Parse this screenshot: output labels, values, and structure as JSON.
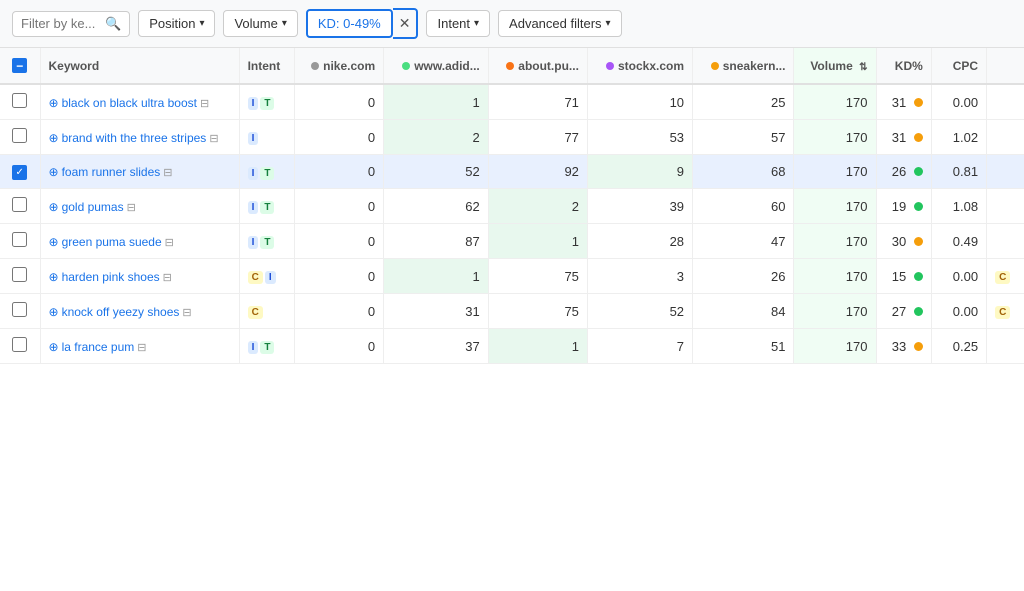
{
  "toolbar": {
    "filter_placeholder": "Filter by ke...",
    "position_label": "Position",
    "volume_label": "Volume",
    "kd_label": "KD: 0-49%",
    "intent_label": "Intent",
    "advanced_label": "Advanced filters"
  },
  "table": {
    "headers": [
      {
        "key": "check",
        "label": ""
      },
      {
        "key": "keyword",
        "label": "Keyword"
      },
      {
        "key": "intent",
        "label": "Intent"
      },
      {
        "key": "nike",
        "label": "nike.com"
      },
      {
        "key": "adidas",
        "label": "www.adid..."
      },
      {
        "key": "about",
        "label": "about.pu..."
      },
      {
        "key": "stockx",
        "label": "stockx.com"
      },
      {
        "key": "sneaker",
        "label": "sneakern..."
      },
      {
        "key": "volume",
        "label": "Volume"
      },
      {
        "key": "kd",
        "label": "KD%"
      },
      {
        "key": "cpc",
        "label": "CPC"
      },
      {
        "key": "extra",
        "label": ""
      }
    ],
    "rows": [
      {
        "id": 1,
        "checked": false,
        "selected": false,
        "keyword": "black on black ultra boost",
        "intents": [
          "I",
          "T"
        ],
        "nike": "0",
        "adidas": "1",
        "adidas_highlight": true,
        "about": "71",
        "stockx": "10",
        "sneaker": "25",
        "volume": "170",
        "kd": "31",
        "kd_color": "yellow",
        "cpc": "0.00",
        "extra": ""
      },
      {
        "id": 2,
        "checked": false,
        "selected": false,
        "keyword": "brand with the three stripes",
        "intents": [
          "I"
        ],
        "nike": "0",
        "adidas": "2",
        "adidas_highlight": true,
        "about": "77",
        "stockx": "53",
        "sneaker": "57",
        "volume": "170",
        "kd": "31",
        "kd_color": "yellow",
        "cpc": "1.02",
        "extra": ""
      },
      {
        "id": 3,
        "checked": true,
        "selected": true,
        "keyword": "foam runner slides",
        "intents": [
          "I",
          "T"
        ],
        "nike": "0",
        "adidas": "52",
        "adidas_highlight": false,
        "about": "92",
        "stockx": "9",
        "stockx_highlight": true,
        "sneaker": "68",
        "volume": "170",
        "kd": "26",
        "kd_color": "green",
        "cpc": "0.81",
        "extra": ""
      },
      {
        "id": 4,
        "checked": false,
        "selected": false,
        "keyword": "gold pumas",
        "intents": [
          "I",
          "T"
        ],
        "nike": "0",
        "adidas": "62",
        "adidas_highlight": false,
        "about": "2",
        "about_highlight": true,
        "stockx": "39",
        "sneaker": "60",
        "volume": "170",
        "kd": "19",
        "kd_color": "green",
        "cpc": "1.08",
        "extra": ""
      },
      {
        "id": 5,
        "checked": false,
        "selected": false,
        "keyword": "green puma suede",
        "intents": [
          "I",
          "T"
        ],
        "nike": "0",
        "adidas": "87",
        "adidas_highlight": false,
        "about": "1",
        "about_highlight": true,
        "stockx": "28",
        "sneaker": "47",
        "volume": "170",
        "kd": "30",
        "kd_color": "yellow",
        "cpc": "0.49",
        "extra": ""
      },
      {
        "id": 6,
        "checked": false,
        "selected": false,
        "keyword": "harden pink shoes",
        "intents": [
          "C",
          "I"
        ],
        "nike": "0",
        "adidas": "1",
        "adidas_highlight": true,
        "about": "75",
        "stockx": "3",
        "sneaker": "26",
        "volume": "170",
        "kd": "15",
        "kd_color": "green",
        "cpc": "0.00",
        "extra": "C"
      },
      {
        "id": 7,
        "checked": false,
        "selected": false,
        "keyword": "knock off yeezy shoes",
        "intents": [
          "C"
        ],
        "nike": "0",
        "adidas": "31",
        "adidas_highlight": false,
        "about": "75",
        "stockx": "52",
        "sneaker": "84",
        "volume": "170",
        "kd": "27",
        "kd_color": "green",
        "cpc": "0.00",
        "extra": "C"
      },
      {
        "id": 8,
        "checked": false,
        "selected": false,
        "keyword": "la france pum",
        "intents": [
          "I",
          "T"
        ],
        "nike": "0",
        "adidas": "37",
        "adidas_highlight": false,
        "about": "1",
        "about_highlight": true,
        "stockx": "7",
        "sneaker": "51",
        "volume": "170",
        "kd": "33",
        "kd_color": "yellow",
        "cpc": "0.25",
        "extra": ""
      }
    ]
  }
}
